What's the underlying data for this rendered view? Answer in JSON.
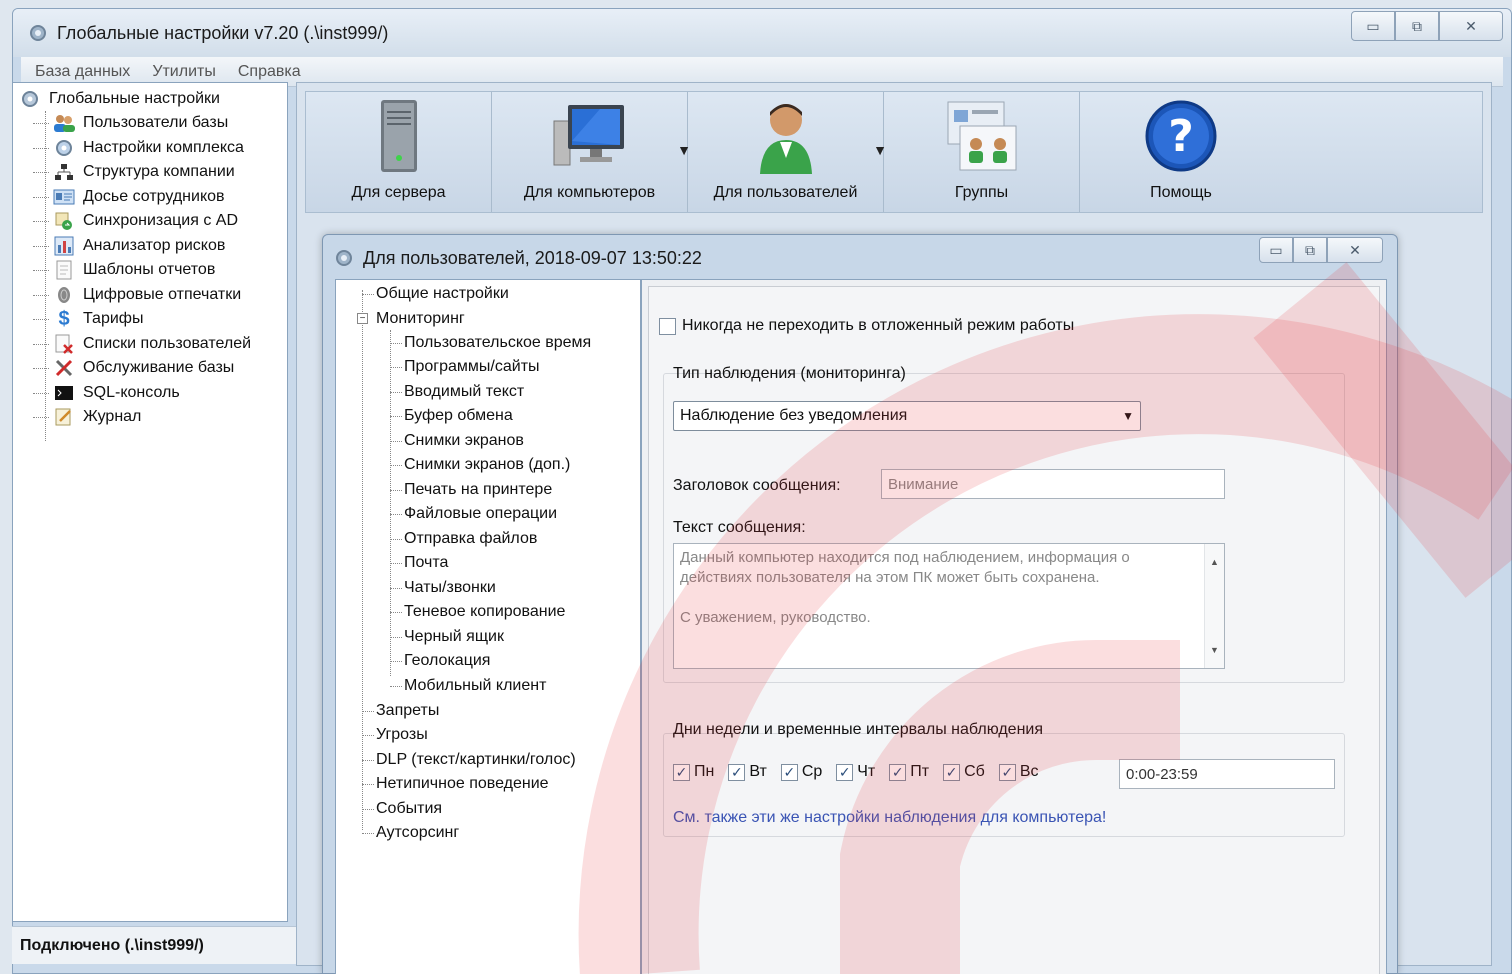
{
  "window": {
    "title": "Глобальные настройки v7.20 (.\\inst999/)"
  },
  "menu": [
    "База данных",
    "Утилиты",
    "Справка"
  ],
  "tree": {
    "root": "Глобальные настройки",
    "items": [
      "Пользователи базы",
      "Настройки комплекса",
      "Структура компании",
      "Досье сотрудников",
      "Синхронизация с AD",
      "Анализатор рисков",
      "Шаблоны отчетов",
      "Цифровые отпечатки",
      "Тарифы",
      "Списки пользователей",
      "Обслуживание базы",
      "SQL-консоль",
      "Журнал"
    ]
  },
  "toolbar": {
    "server": "Для сервера",
    "computers": "Для компьютеров",
    "users": "Для пользователей",
    "groups": "Группы",
    "help": "Помощь"
  },
  "dialog": {
    "title": "Для пользователей, 2018-09-07 13:50:22",
    "subtree": {
      "general": "Общие настройки",
      "monitoring": "Мониторинг",
      "monitoring_children": [
        "Пользовательское время",
        "Программы/сайты",
        "Вводимый текст",
        "Буфер обмена",
        "Снимки экранов",
        "Снимки экранов (доп.)",
        "Печать на принтере",
        "Файловые операции",
        "Отправка файлов",
        "Почта",
        "Чаты/звонки",
        "Теневое копирование",
        "Черный ящик",
        "Геолокация",
        "Мобильный клиент"
      ],
      "other": [
        "Запреты",
        "Угрозы",
        "DLP (текст/картинки/голос)",
        "Нетипичное поведение",
        "События",
        "Аутсорсинг"
      ]
    },
    "never_suspend_label": "Никогда не переходить в отложенный режим работы",
    "never_suspend_checked": false,
    "monitoring_type_label": "Тип наблюдения (мониторинга)",
    "monitoring_type_value": "Наблюдение без уведомления",
    "message_title_label": "Заголовок сообщения:",
    "message_title_value": "Внимание",
    "message_text_label": "Текст сообщения:",
    "message_text_line1": "Данный компьютер находится под наблюдением, информация о",
    "message_text_line2": "действиях пользователя на этом ПК может быть сохранена.",
    "message_text_line3": "С уважением, руководство.",
    "days_label": "Дни недели и временные интервалы наблюдения",
    "days": [
      {
        "label": "Пн",
        "checked": true
      },
      {
        "label": "Вт",
        "checked": true
      },
      {
        "label": "Ср",
        "checked": true
      },
      {
        "label": "Чт",
        "checked": true
      },
      {
        "label": "Пт",
        "checked": true
      },
      {
        "label": "Сб",
        "checked": true
      },
      {
        "label": "Вс",
        "checked": true
      }
    ],
    "interval_value": "0:00-23:59",
    "see_also_link": "См. также эти же настройки наблюдения для компьютера!"
  },
  "status": {
    "text": "Подключено (.\\inst999/)"
  },
  "colors": {
    "watermark": "#e8313a",
    "link": "#3a54b4"
  }
}
